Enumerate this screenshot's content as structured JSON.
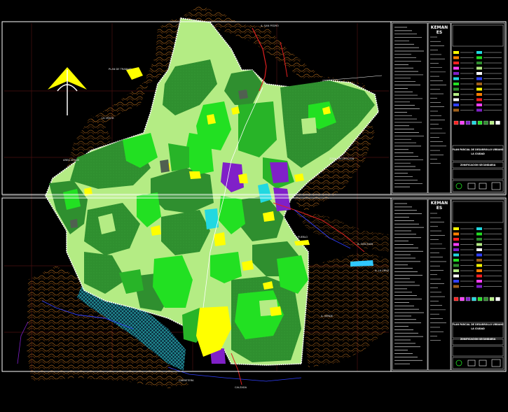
{
  "map": {
    "sheets": [
      "upper-sheet",
      "lower-sheet"
    ],
    "colors": {
      "background": "#000000",
      "frame": "#ffffff",
      "grid": "#4a1010",
      "contours": "#a0601a",
      "boundary": "#ffffff",
      "green_dark": "#2f8f2f",
      "green_mid": "#28b428",
      "green_bright": "#22e022",
      "green_light": "#b4ec84",
      "yellow": "#ffff00",
      "purple": "#8020c8",
      "cyan": "#22d8e0",
      "red_road": "#e02020",
      "blue_river": "#3040ff",
      "urban_cyan": "#30c8c8"
    },
    "north_arrow": {
      "icon": "north-arrow-icon",
      "color": "#ffff00"
    }
  },
  "legend": {
    "upper": {
      "badge": "KEMAN\nES",
      "footer_title_1": "PLAN PARCIAL DE DESARROLLO URBANO",
      "footer_title_2": "LA CIUDAD",
      "footer_subtitle": "ZONIFICACION SECUNDARIA"
    },
    "lower": {
      "badge": "KEMAN\nES",
      "footer_title_1": "PLAN PARCIAL DE DESARROLLO URBANO",
      "footer_title_2": "LA CIUDAD",
      "footer_subtitle": "ZONIFICACION SECUNDARIA"
    },
    "swatch_colors": [
      "#ffff00",
      "#ff8000",
      "#ff2020",
      "#ff40ff",
      "#8020c8",
      "#22d8e0",
      "#22e022",
      "#2f8f2f",
      "#b4ec84",
      "#ffffff",
      "#3040ff",
      "#a0601a"
    ]
  }
}
